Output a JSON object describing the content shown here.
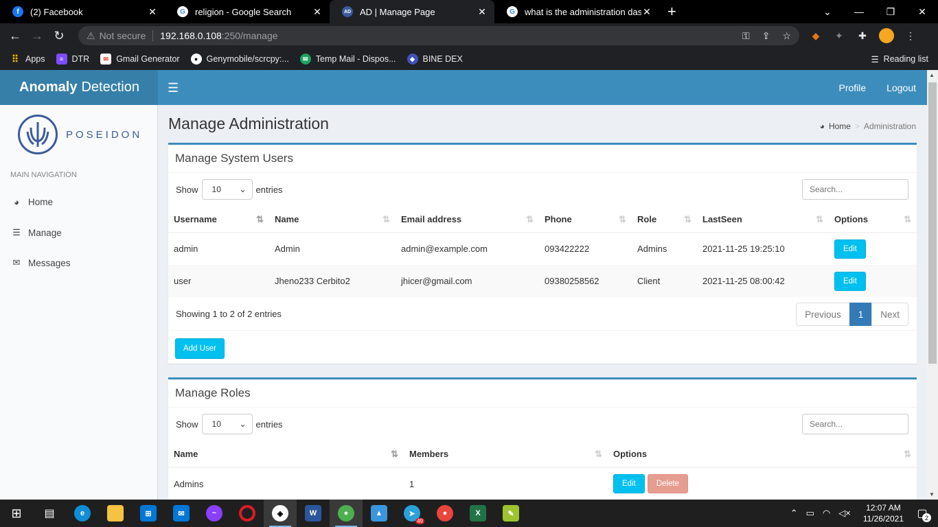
{
  "browser": {
    "tabs": [
      {
        "title": "(2) Facebook",
        "favicon": "facebook-icon",
        "color": "#1877f2",
        "active": false
      },
      {
        "title": "religion - Google Search",
        "favicon": "google-icon",
        "color": "#ffffff",
        "active": false
      },
      {
        "title": "AD | Manage Page",
        "favicon": "site-icon",
        "color": "#3b5b9a",
        "active": true
      },
      {
        "title": "what is the administration dashbo",
        "favicon": "google-icon",
        "color": "#ffffff",
        "active": false
      }
    ],
    "address": {
      "security": "Not secure",
      "host": "192.168.0.108",
      "path": ":250/manage"
    },
    "bookmarks": [
      {
        "label": "Apps",
        "color": "#f4b400"
      },
      {
        "label": "DTR",
        "color": "#7c4dff"
      },
      {
        "label": "Gmail Generator",
        "color": "#ea4335"
      },
      {
        "label": "Genymobile/scrcpy:...",
        "color": "#ffffff"
      },
      {
        "label": "Temp Mail - Dispos...",
        "color": "#1aa260"
      },
      {
        "label": "BINE DEX",
        "color": "#3f51b5"
      }
    ],
    "reading_list": "Reading list"
  },
  "app": {
    "logo_bold": "Anomaly",
    "logo_rest": "Detection",
    "nav_profile": "Profile",
    "nav_logout": "Logout",
    "brand_word": "POSEIDON",
    "nav_header": "MAIN NAVIGATION",
    "nav_items": [
      {
        "label": "Home",
        "icon": "dashboard-icon"
      },
      {
        "label": "Manage",
        "icon": "database-icon"
      },
      {
        "label": "Messages",
        "icon": "envelope-icon"
      }
    ],
    "page_title": "Manage Administration",
    "breadcrumb": {
      "home": "Home",
      "current": "Administration"
    }
  },
  "users_box": {
    "title": "Manage System Users",
    "show": "Show",
    "entries": "entries",
    "page_size": "10",
    "search_placeholder": "Search...",
    "columns": [
      "Username",
      "Name",
      "Email address",
      "Phone",
      "Role",
      "LastSeen",
      "Options"
    ],
    "rows": [
      {
        "username": "admin",
        "name": "Admin",
        "email": "admin@example.com",
        "phone": "093422222",
        "role": "Admins",
        "lastseen": "2021-11-25 19:25:10",
        "option": "Edit"
      },
      {
        "username": "user",
        "name": "Jheno233 Cerbito2",
        "email": "jhicer@gmail.com",
        "phone": "09380258562",
        "role": "Client",
        "lastseen": "2021-11-25 08:00:42",
        "option": "Edit"
      }
    ],
    "info": "Showing 1 to 2 of 2 entries",
    "pager": {
      "prev": "Previous",
      "page": "1",
      "next": "Next"
    },
    "add_button": "Add User"
  },
  "roles_box": {
    "title": "Manage Roles",
    "show": "Show",
    "entries": "entries",
    "page_size": "10",
    "search_placeholder": "Search...",
    "columns": [
      "Name",
      "Members",
      "Options"
    ],
    "rows": [
      {
        "name": "Admins",
        "members": "1",
        "edit": "Edit",
        "delete": "Delete"
      }
    ]
  },
  "taskbar": {
    "time": "12:07 AM",
    "date": "11/26/2021",
    "notifications": "2",
    "telegram_badge": "49"
  }
}
